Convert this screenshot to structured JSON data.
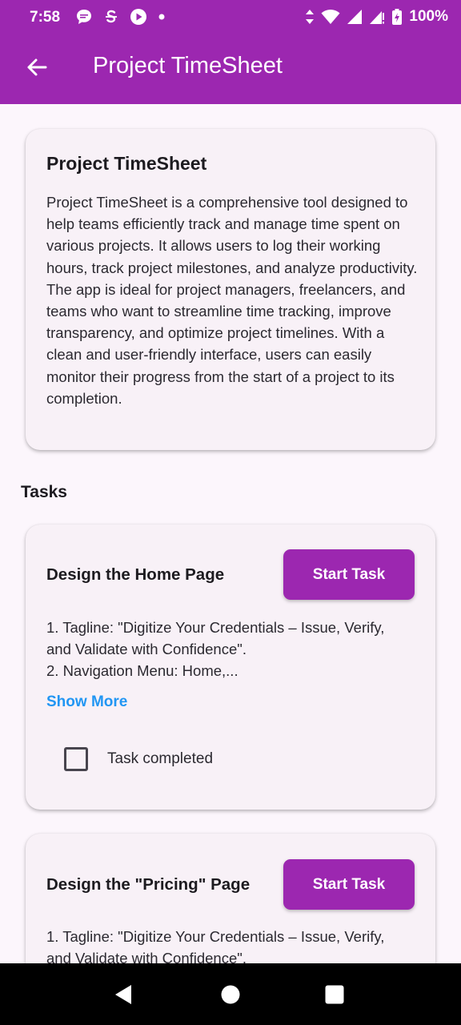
{
  "status_bar": {
    "time": "7:58",
    "battery": "100%",
    "left_icons": [
      "chat-bubble-icon",
      "s-app-icon",
      "play-icon",
      "dot-icon"
    ],
    "right_icons": [
      "data-arrows-icon",
      "wifi-icon",
      "signal-icon",
      "signal-alert-icon",
      "battery-charging-icon"
    ]
  },
  "app_bar": {
    "title": "Project TimeSheet",
    "back_icon": "arrow-back-icon",
    "color": "#9c27b0"
  },
  "about": {
    "title": "Project TimeSheet",
    "description": "Project TimeSheet is a comprehensive tool designed to help teams efficiently track and manage time spent on various projects. It allows users to log their working hours, track project milestones, and analyze productivity. The app is ideal for project managers, freelancers, and teams who want to streamline time tracking, improve transparency, and optimize project timelines. With a clean and user-friendly interface, users can easily monitor their progress from the start of a project to its completion."
  },
  "tasks_heading": "Tasks",
  "tasks": [
    {
      "title": "Design the Home Page",
      "button": "Start Task",
      "description_lines": [
        "1. Tagline: \"Digitize Your Credentials – Issue, Verify,",
        "and Validate with Confidence\".",
        "2. Navigation Menu: Home,..."
      ],
      "show_more": "Show More",
      "completed_label": "Task completed",
      "completed": false
    },
    {
      "title": "Design the \"Pricing\" Page",
      "button": "Start Task",
      "description_lines": [
        "1. Tagline: \"Digitize Your Credentials – Issue, Verify,",
        "and Validate with Confidence\"."
      ]
    }
  ],
  "nav_bar": {
    "icons": [
      "back-triangle-icon",
      "home-circle-icon",
      "recents-square-icon"
    ]
  }
}
